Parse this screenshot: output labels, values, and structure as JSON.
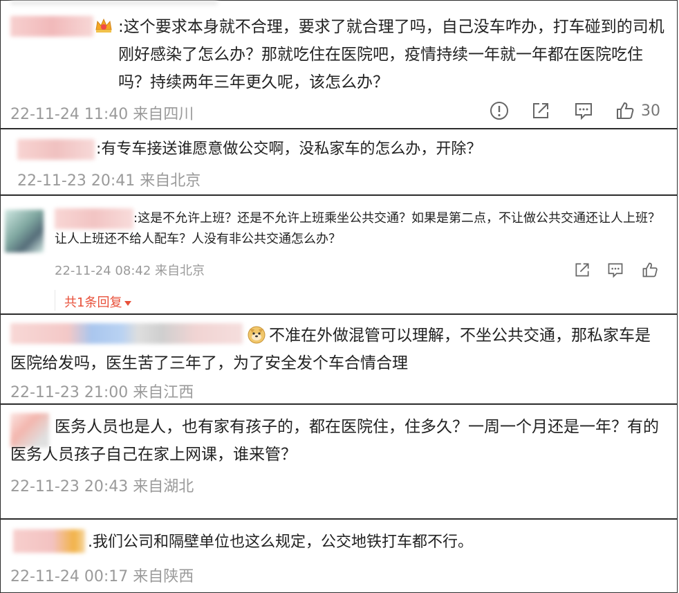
{
  "comments": [
    {
      "text": ":这个要求本身就不合理，要求了就合理了吗，自己没车咋办，打车碰到的司机刚好感染了怎么办？那就吃住在医院吧，疫情持续一年就一年都在医院吃住吗？持续两年三年更久呢，该怎么办？",
      "meta": "22-11-24 11:40 来自四川",
      "likes": "30"
    },
    {
      "text": ":有专车接送谁愿意做公交啊，没私家车的怎么办，开除？",
      "meta": "22-11-23 20:41 来自北京"
    },
    {
      "text": ":这是不允许上班？还是不允许上班乘坐公共交通？如果是第二点，不让做公共交通还让人上班？让人上班还不给人配车？人没有非公共交通怎么办？",
      "meta": "22-11-24 08:42 来自北京",
      "reply_label": "共1条回复"
    },
    {
      "text": "不准在外做混管可以理解，不坐公共交通，那私家车是医院给发吗，医生苦了三年了，为了安全发个车合情合理",
      "meta": "22-11-23 21:00 来自江西"
    },
    {
      "text": "医务人员也是人，也有家有孩子的，都在医院住，住多久？一周一个月还是一年？有的医务人员孩子自己在家上网课，谁来管？",
      "meta": "22-11-23 20:43 来自湖北"
    },
    {
      "text": ".我们公司和隔壁单位也这么规定，公交地铁打车都不行。",
      "meta": "22-11-24 00:17 来自陕西"
    }
  ],
  "icons": {
    "report": "report-icon",
    "share": "share-icon",
    "comment": "comment-icon",
    "like": "like-icon",
    "crown": "crown-badge-icon",
    "doge": "doge-emoji-icon"
  },
  "colors": {
    "meta": "#9a9a9a",
    "reply": "#e8503a",
    "border": "#2b2b2b"
  }
}
